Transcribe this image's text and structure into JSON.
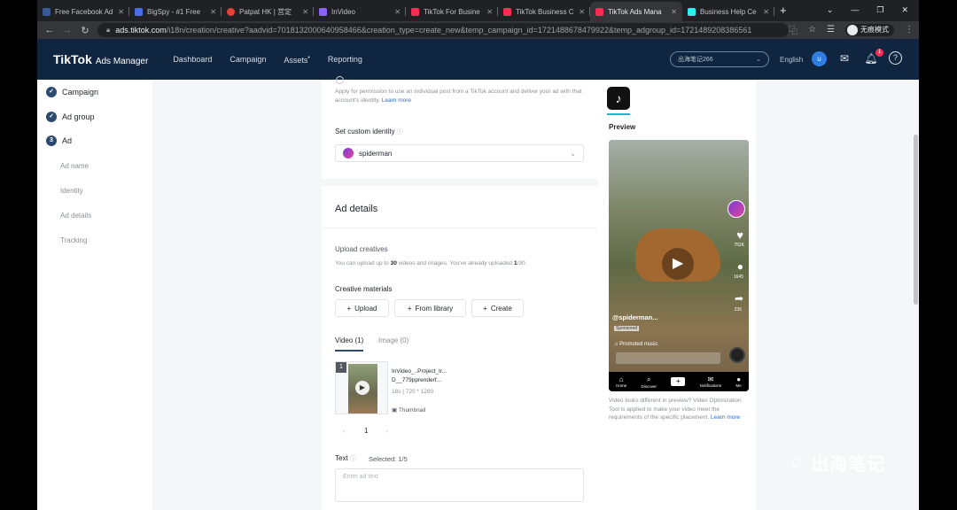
{
  "browser": {
    "tabs": [
      {
        "title": "Free Facebook Ad",
        "color": "#3b5998",
        "active": false
      },
      {
        "title": "BigSpy - #1 Free",
        "color": "#4b6ee8",
        "active": false
      },
      {
        "title": "Patpat HK | 営定",
        "color": "#e94235",
        "active": false
      },
      {
        "title": "InVideo",
        "color": "#8a63ff",
        "active": false
      },
      {
        "title": "TikTok For Busine",
        "color": "#fe2c55",
        "active": false
      },
      {
        "title": "TikTok Business C",
        "color": "#fe2c55",
        "active": false
      },
      {
        "title": "TikTok Ads Mana",
        "color": "#fe2c55",
        "active": true
      },
      {
        "title": "Business Help Ce",
        "color": "#25f4ee",
        "active": false
      }
    ],
    "url_host": "ads.tiktok.com",
    "url_path": "/i18n/creation/creative?aadvid=7018132000640958466&creation_type=create_new&temp_campaign_id=1721488678479922&temp_adgroup_id=1721489208386561",
    "profile_label": "无痕模式"
  },
  "header": {
    "logo": "TikTok",
    "logo_sub": "Ads Manager",
    "nav": [
      "Dashboard",
      "Campaign",
      "Assets",
      "Reporting"
    ],
    "account": "出海笔记266",
    "language": "English",
    "avatar_letter": "u",
    "notification_count": "1"
  },
  "steps": {
    "campaign": "Campaign",
    "adgroup": "Ad group",
    "ad_num": "3",
    "ad": "Ad",
    "sub": [
      "Ad name",
      "Identity",
      "Ad details",
      "Tracking"
    ]
  },
  "identity": {
    "desc": "Apply for permission to use an individual post from a TikTok account and deliver your ad with that account's identity.",
    "learn_more": "Learn more",
    "custom_label": "Set custom identity",
    "selected": "spiderman"
  },
  "ad_details": {
    "title": "Ad details",
    "upload_title": "Upload creatives",
    "upload_desc_pre": "You can upload up to ",
    "upload_max": "30",
    "upload_desc_mid": " videos and images. You've already uploaded ",
    "upload_count": "1",
    "upload_desc_post": "/30.",
    "materials_label": "Creative materials",
    "buttons": {
      "upload": "Upload",
      "library": "From library",
      "create": "Create"
    },
    "tabs": {
      "video": "Video (1)",
      "image": "Image (0)"
    },
    "video": {
      "index": "1",
      "name_line1": "InVideo_..Project_Ir...",
      "name_line2": "D__779pprenderf...",
      "meta": "18s | 720 * 1280",
      "thumbnail_label": "Thumbnail"
    },
    "pagination": {
      "prev": "‹",
      "page": "1",
      "next": "›"
    },
    "text_label": "Text",
    "selected_label": "Selected: 1/5",
    "text_placeholder": "Enter ad text"
  },
  "preview": {
    "title": "Preview",
    "username": "@spiderman...",
    "sponsored": "Sponsored",
    "music": "Promoted music",
    "counts": {
      "likes": "752K",
      "comments": "1645",
      "shares": "236"
    },
    "bottom_nav": [
      "Home",
      "Discover",
      "",
      "Notifications",
      "Me"
    ],
    "note": "Video looks different in preview? Video Optimization Tool is applied to make your video meet the requirements of the specific placement.",
    "learn_more": "Learn more"
  },
  "watermark": "出海笔记"
}
